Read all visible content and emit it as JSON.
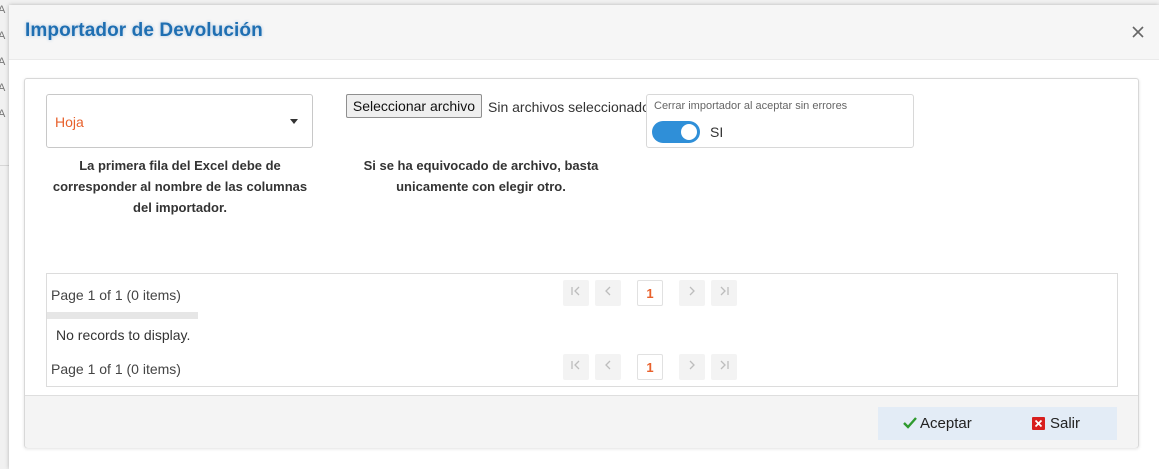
{
  "background": {
    "letters": [
      "A",
      "A",
      "A",
      "A"
    ]
  },
  "modal": {
    "title": "Importador de Devolución",
    "close_icon": "close-icon"
  },
  "form": {
    "sheet_dropdown": {
      "value": "Hoja",
      "caret_icon": "chevron-down-icon"
    },
    "sheet_note": "La primera fila del Excel debe de corresponder al nombre de las columnas del importador.",
    "file_button_label": "Seleccionar archivo",
    "file_status": "Sin archivos seleccionados",
    "file_note": "Si se ha equivocado de archivo, basta unicamente con elegir otro.",
    "toggle": {
      "caption": "Cerrar importador al aceptar sin errores",
      "label": "SI",
      "on": true
    }
  },
  "grid": {
    "pager_info": "Page 1 of 1 (0 items)",
    "current_page": "1",
    "no_records": "No records to display.",
    "pager_icons": {
      "first": "first-page-icon",
      "prev": "prev-page-icon",
      "next": "next-page-icon",
      "last": "last-page-icon"
    }
  },
  "footer": {
    "accept_label": "Aceptar",
    "exit_label": "Salir"
  },
  "colors": {
    "title": "#1f6fb2",
    "accent_orange": "#e8612c",
    "toggle_on": "#2f8fd8",
    "check_green": "#2e9a2e",
    "exit_red": "#d81e1e"
  }
}
